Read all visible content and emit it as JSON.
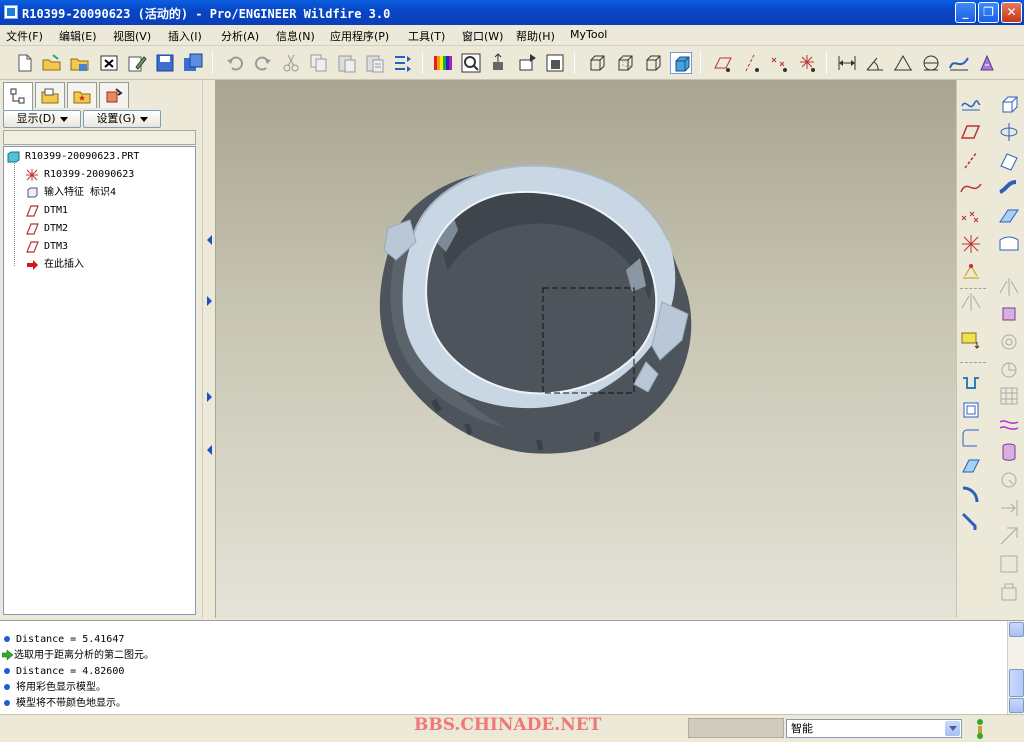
{
  "window": {
    "title": "R10399-20090623 (活动的) - Pro/ENGINEER Wildfire 3.0",
    "minimize": "_",
    "maximize": "❐",
    "close": "✕"
  },
  "menu": [
    {
      "label": "文件(F)"
    },
    {
      "label": "编辑(E)"
    },
    {
      "label": "视图(V)"
    },
    {
      "label": "插入(I)"
    },
    {
      "label": "分析(A)"
    },
    {
      "label": "信息(N)"
    },
    {
      "label": "应用程序(P)"
    },
    {
      "label": "工具(T)"
    },
    {
      "label": "窗口(W)"
    },
    {
      "label": "帮助(H)"
    },
    {
      "label": "MyTool"
    }
  ],
  "left_panel": {
    "show_button": "显示(D)",
    "settings_button": "设置(G)",
    "tree": [
      {
        "label": "R10399-20090623.PRT",
        "icon": "part-icon"
      },
      {
        "label": "R10399-20090623",
        "icon": "csys-icon"
      },
      {
        "label": "输入特征 标识4",
        "icon": "import-feature-icon"
      },
      {
        "label": "DTM1",
        "icon": "datum-plane-icon"
      },
      {
        "label": "DTM2",
        "icon": "datum-plane-icon"
      },
      {
        "label": "DTM3",
        "icon": "datum-plane-icon"
      },
      {
        "label": "在此插入",
        "icon": "insert-here-arrow-icon"
      }
    ]
  },
  "messages": [
    {
      "text": "Distance = 5.41647",
      "type": "info"
    },
    {
      "text": "选取用于距离分析的第二图元。",
      "type": "prompt"
    },
    {
      "text": "Distance = 4.82600",
      "type": "info"
    },
    {
      "text": "将用彩色显示模型。",
      "type": "info"
    },
    {
      "text": "模型将不带颜色地显示。",
      "type": "info"
    }
  ],
  "status": {
    "watermark": "BBS.CHINADE.NET",
    "filter_value": "智能"
  },
  "colors": {
    "titlebar": "#0a46c8",
    "model_light": "#c9d6e4",
    "model_dark": "#4d545c",
    "watermark": "#f07878"
  }
}
